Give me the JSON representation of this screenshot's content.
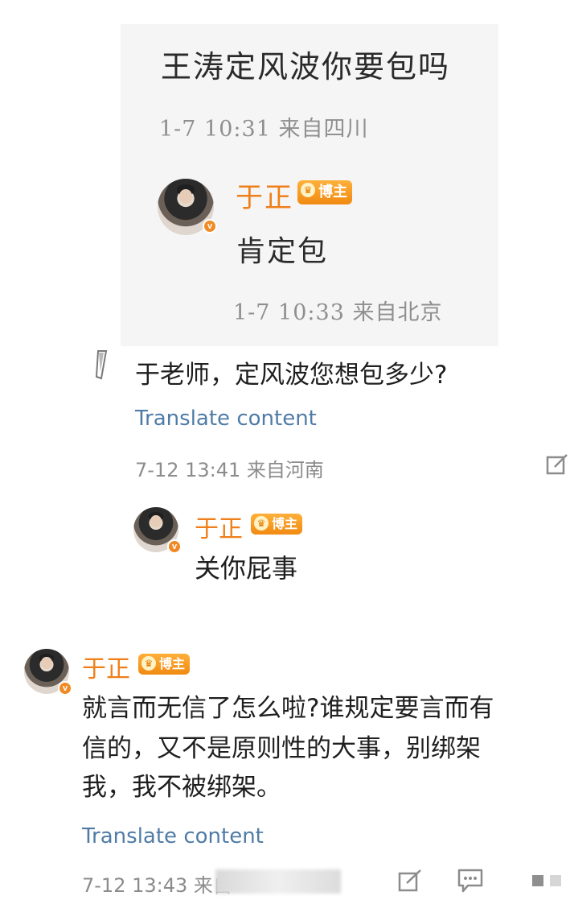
{
  "screenshot": {
    "text": "王涛定风波你要包吗",
    "time": "1-7 10:31 来自四川",
    "reply": {
      "author": "于正",
      "badge": "博主",
      "text": "肯定包",
      "time": "1-7 10:33 来自北京"
    }
  },
  "comment1": {
    "text": "于老师，定风波您想包多少?",
    "translate_label": "Translate content",
    "time": "7-12 13:41 来自河南",
    "reply": {
      "author": "于正",
      "badge": "博主",
      "text": "关你屁事"
    }
  },
  "comment2": {
    "author": "于正",
    "badge": "博主",
    "text_line1": "就言而无信了怎么啦?谁规定要言而有",
    "text_line2": "信的，又不是原则性的大事，别绑架",
    "text_line3": "我，我不被绑架。",
    "translate_label": "Translate content",
    "time": "7-12 13:43 来自"
  },
  "icons": {
    "share": "share-edit-icon",
    "comment": "comment-icon",
    "more": "more-icon"
  }
}
